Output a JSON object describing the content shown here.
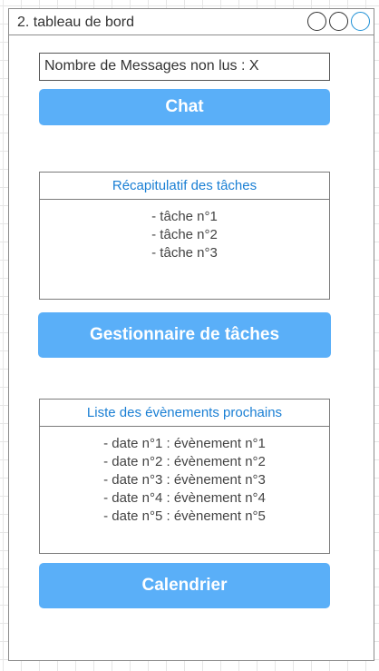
{
  "window": {
    "title": "2. tableau de bord"
  },
  "messages": {
    "label": "Nombre de Messages non lus : X"
  },
  "buttons": {
    "chat": "Chat",
    "tasks": "Gestionnaire de tâches",
    "calendar": "Calendrier"
  },
  "tasks_panel": {
    "title": "Récapitulatif des tâches",
    "items": [
      "- tâche n°1",
      "- tâche n°2",
      "- tâche n°3"
    ]
  },
  "events_panel": {
    "title": "Liste des évènements prochains",
    "items": [
      "- date n°1 : évènement n°1",
      "- date n°2 : évènement n°2",
      "- date n°3 : évènement n°3",
      "- date n°4 : évènement n°4",
      "- date n°5 : évènement n°5"
    ]
  },
  "colors": {
    "accent": "#5aaff8",
    "heading": "#1a7fd4"
  }
}
